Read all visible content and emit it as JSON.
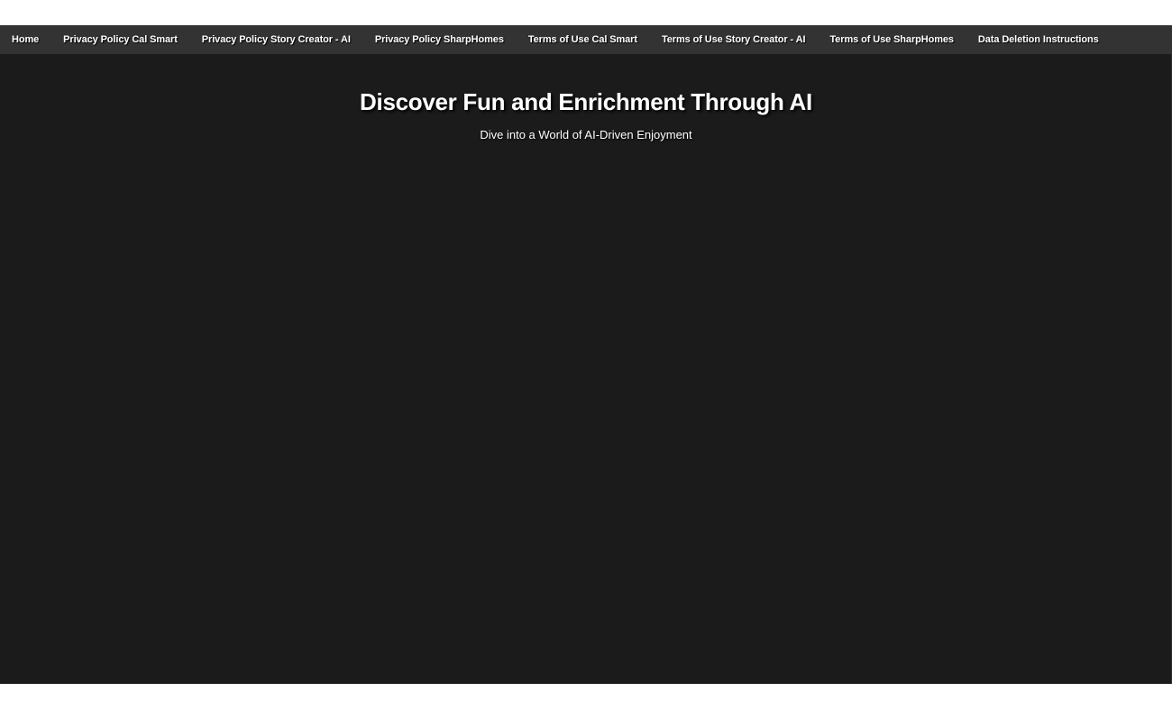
{
  "nav": {
    "items": [
      {
        "label": "Home"
      },
      {
        "label": "Privacy Policy Cal Smart"
      },
      {
        "label": "Privacy Policy Story Creator - AI"
      },
      {
        "label": "Privacy Policy SharpHomes"
      },
      {
        "label": "Terms of Use Cal Smart"
      },
      {
        "label": "Terms of Use Story Creator - AI"
      },
      {
        "label": "Terms of Use SharpHomes"
      },
      {
        "label": "Data Deletion Instructions"
      }
    ]
  },
  "hero": {
    "title": "Discover Fun and Enrichment Through AI",
    "subtitle": "Dive into a World of AI-Driven Enjoyment"
  },
  "colors": {
    "page_background": "#1b1b1b",
    "nav_background": "#333333",
    "text": "#ffffff"
  }
}
